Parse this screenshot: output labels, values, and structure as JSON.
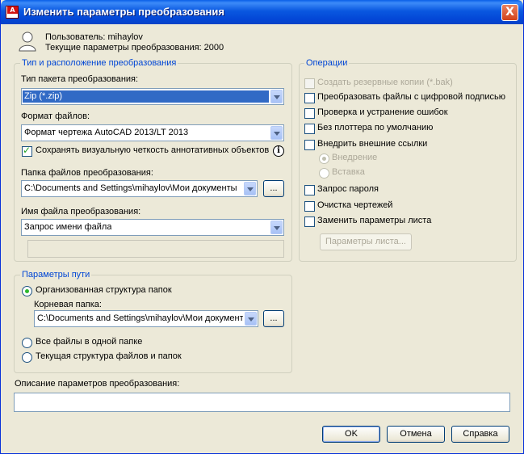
{
  "window": {
    "title": "Изменить параметры преобразования",
    "close_label": "X"
  },
  "header": {
    "user_line": "Пользователь: mihaylov",
    "current_line": "Текущие параметры преобразования: 2000"
  },
  "type_group": {
    "title": "Тип и расположение преобразования",
    "package_label": "Тип пакета преобразования:",
    "package_value": "Zip (*.zip)",
    "format_label": "Формат файлов:",
    "format_value": "Формат чертежа AutoCAD 2013/LT 2013",
    "annotative_label": "Сохранять визуальную четкость аннотативных объектов",
    "annotative_checked": true,
    "folder_label": "Папка файлов преобразования:",
    "folder_value": "C:\\Documents and Settings\\mihaylov\\Мои документы",
    "browse_label": "...",
    "filename_label": "Имя файла преобразования:",
    "filename_value": "Запрос имени файла",
    "filename_text": ""
  },
  "path_group": {
    "title": "Параметры пути",
    "organized_label": "Организованная структура папок",
    "root_label": "Корневая папка:",
    "root_value": "C:\\Documents and Settings\\mihaylov\\Мои документ",
    "browse_label": "...",
    "all_one_label": "Все файлы в одной папке",
    "current_struct_label": "Текущая структура файлов и папок",
    "selected": "organized"
  },
  "ops_group": {
    "title": "Операции",
    "backup_label": "Создать резервные копии (*.bak)",
    "digital_sig_label": "Преобразовать файлы с цифровой подписью",
    "audit_label": "Проверка и устранение ошибок",
    "no_plotter_label": "Без плоттера по умолчанию",
    "bind_xref_label": "Внедрить внешние ссылки",
    "bind_label": "Внедрение",
    "insert_label": "Вставка",
    "password_label": "Запрос пароля",
    "purge_label": "Очистка чертежей",
    "page_setups_label": "Заменить параметры листа",
    "page_setups_btn": "Параметры листа..."
  },
  "description": {
    "label": "Описание параметров преобразования:",
    "value": ""
  },
  "buttons": {
    "ok": "OK",
    "cancel": "Отмена",
    "help": "Справка"
  },
  "colors": {
    "title_bar": "#0a58e0",
    "group_title": "#0046d5",
    "selection": "#316ac5",
    "face": "#ece9d8"
  }
}
